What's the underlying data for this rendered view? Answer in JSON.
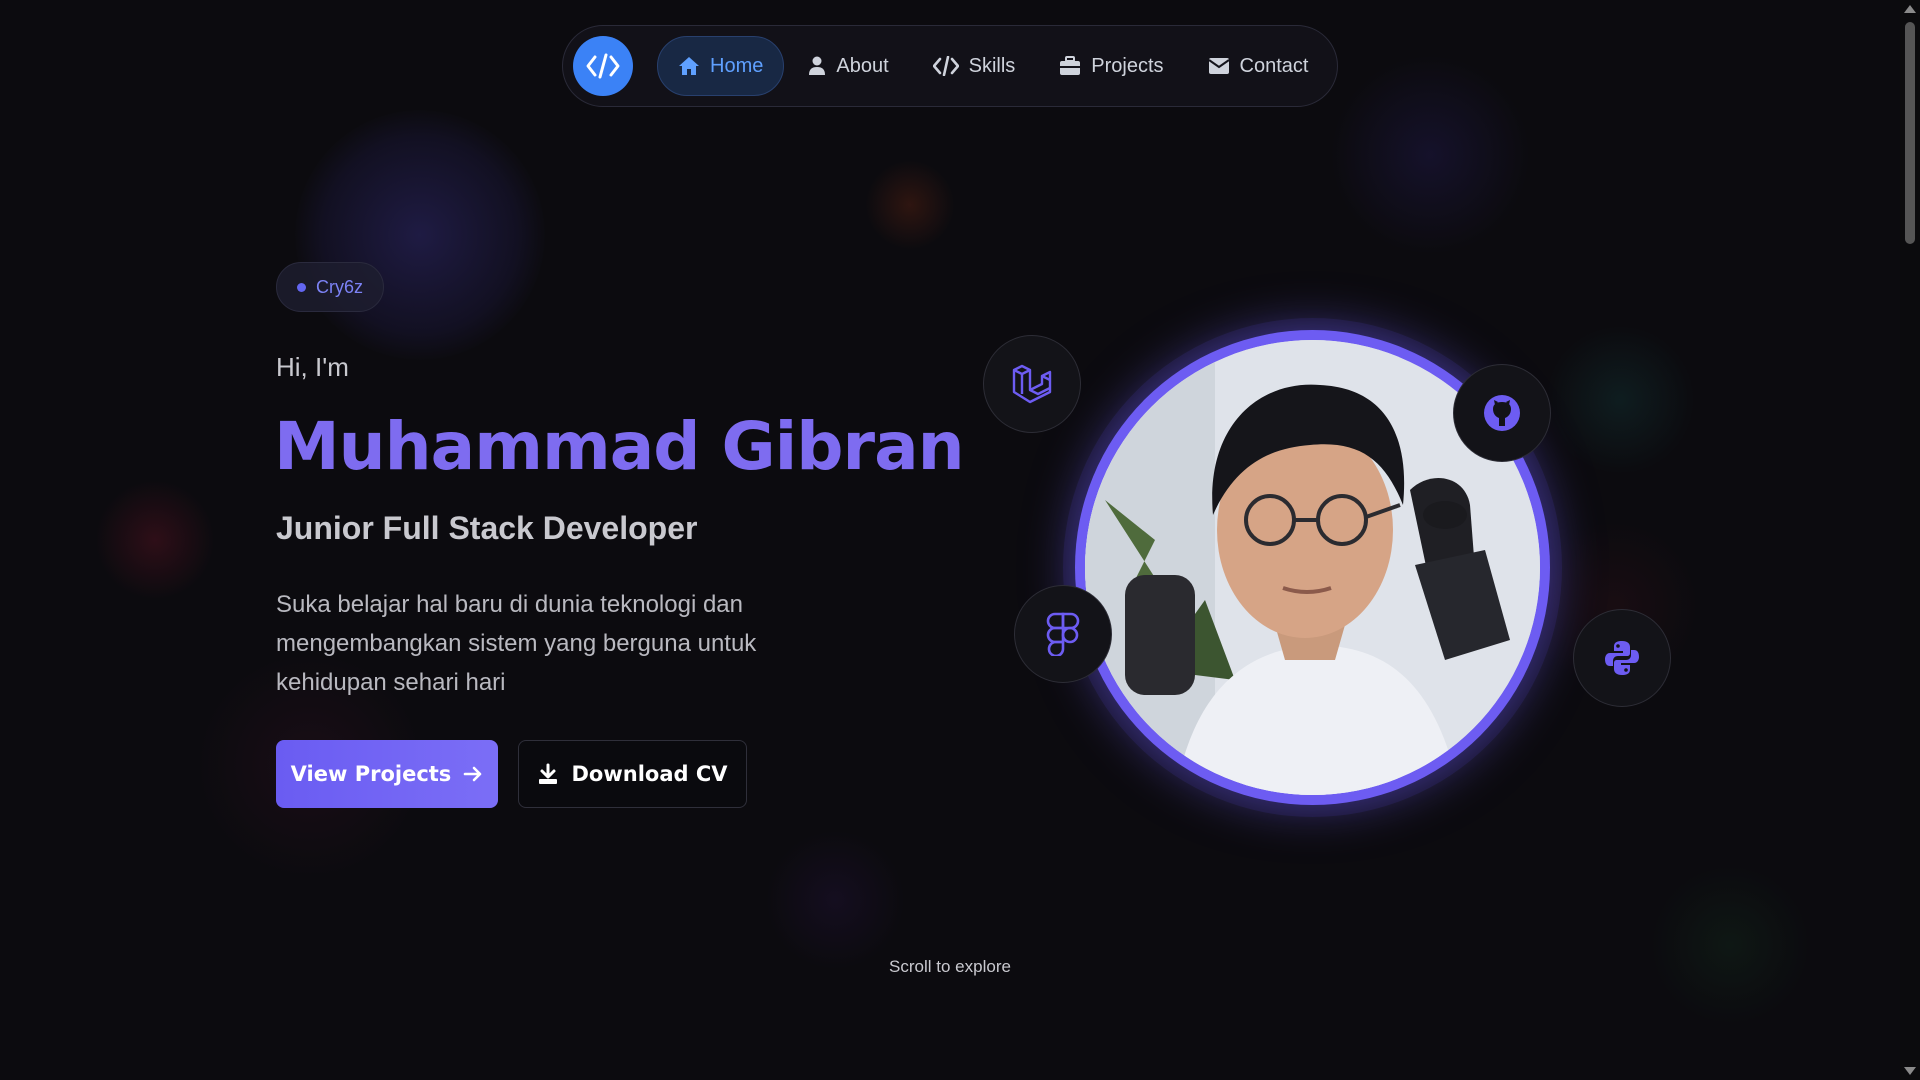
{
  "nav": {
    "logo_icon": "code-icon",
    "items": [
      {
        "label": "Home",
        "icon": "home-icon",
        "active": true
      },
      {
        "label": "About",
        "icon": "user-icon",
        "active": false
      },
      {
        "label": "Skills",
        "icon": "code-icon",
        "active": false
      },
      {
        "label": "Projects",
        "icon": "briefcase-icon",
        "active": false
      },
      {
        "label": "Contact",
        "icon": "envelope-icon",
        "active": false
      }
    ]
  },
  "hero": {
    "badge": "Cry6z",
    "greeting": "Hi, I'm",
    "name": "Muhammad Gibran",
    "role": "Junior Full Stack Developer",
    "description": "Suka belajar hal baru di dunia teknologi dan mengembangkan sistem yang berguna untuk kehidupan sehari hari",
    "primary_button": "View Projects",
    "secondary_button": "Download CV"
  },
  "floating_icons": [
    "laravel-icon",
    "github-icon",
    "figma-icon",
    "python-icon"
  ],
  "scroll_hint": "Scroll to explore",
  "colors": {
    "accent": "#6d5cf2",
    "nav_active": "#5fa0ff",
    "logo_bg": "#3b82f6",
    "background": "#0c0b0f"
  }
}
